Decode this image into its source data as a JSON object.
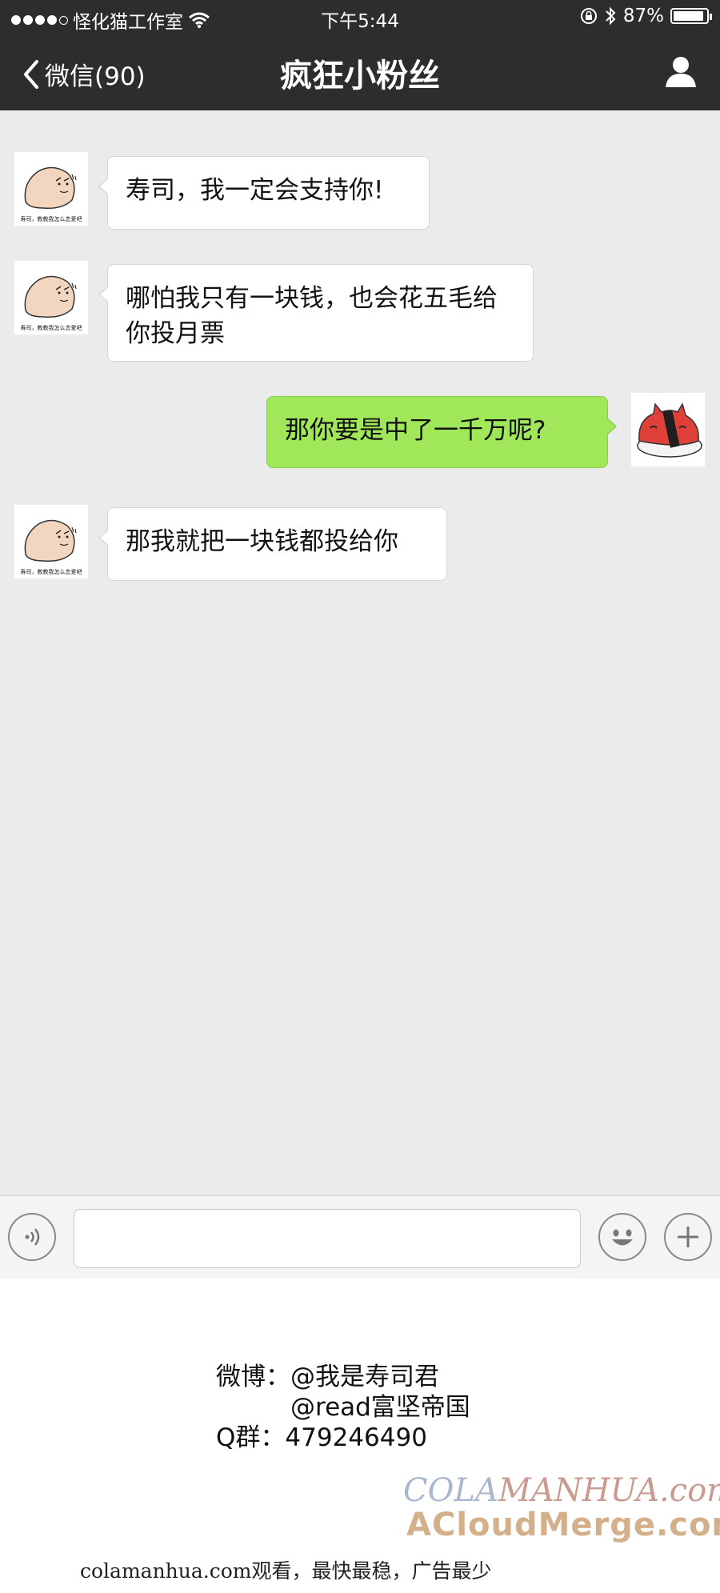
{
  "status_bar": {
    "carrier": "怪化猫工作室",
    "time": "下午5:44",
    "battery": "87%",
    "battery_level": 0.87
  },
  "nav": {
    "back_label": "微信(90)",
    "title": "疯狂小粉丝"
  },
  "messages": [
    {
      "side": "in",
      "text": "寿司，我一定会支持你!"
    },
    {
      "side": "in",
      "text": "哪怕我只有一块钱，也会花五毛给你投月票"
    },
    {
      "side": "out",
      "text": "那你要是中了一千万呢?"
    },
    {
      "side": "in",
      "text": "那我就把一块钱都投给你"
    }
  ],
  "avatar_caption": "寿司，教教我怎么恋爱吧",
  "input": {
    "value": "",
    "placeholder": ""
  },
  "footer": {
    "weibo_label": "微博：",
    "weibo_1": "@我是寿司君",
    "weibo_2": "@read富坚帝国",
    "qq_label": "Q群：",
    "qq_number": "479246490",
    "watermark_1a": "COLA",
    "watermark_1b": "MANHUA.com",
    "watermark_2": "ACloudMerge.com",
    "note": "colamanhua.com观看，最快最稳，广告最少"
  },
  "colors": {
    "header_bg": "#2d2d2d",
    "chat_bg": "#ebebeb",
    "incoming_bubble": "#ffffff",
    "outgoing_bubble": "#a0e75a"
  },
  "icons": [
    "wifi-icon",
    "lock-rotation-icon",
    "bluetooth-icon",
    "battery-icon",
    "back-chevron-icon",
    "profile-icon",
    "voice-icon",
    "emoji-icon",
    "plus-icon"
  ]
}
